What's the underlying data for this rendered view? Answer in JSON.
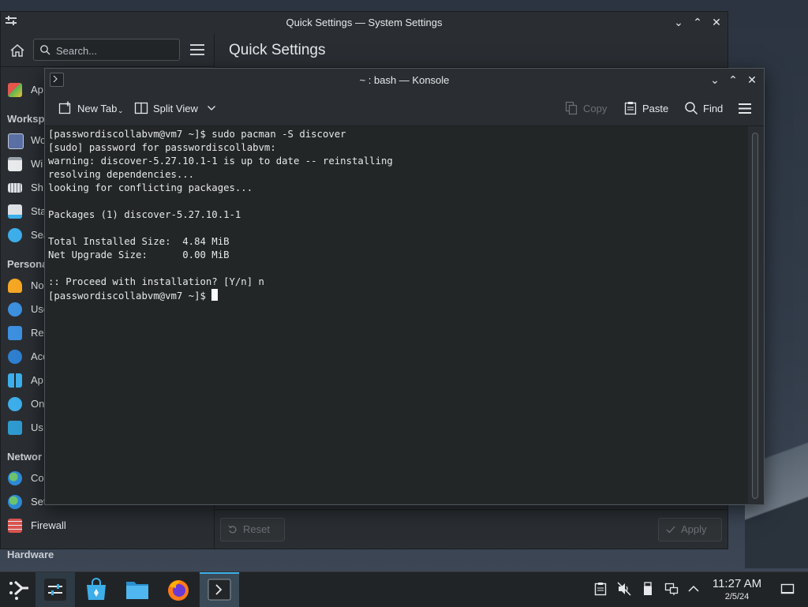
{
  "desktop": {
    "background_color": "#2f3a46"
  },
  "system_settings": {
    "title": "Quick Settings — System Settings",
    "search_placeholder": "Search...",
    "main_title": "Quick Settings",
    "sidebar": {
      "item_apps": "Ap",
      "section_workspace": "Worksp",
      "workspace_items": [
        "Wo",
        "Wi",
        "Sh",
        "Sta",
        "Sea"
      ],
      "section_personal": "Persona",
      "personal_items": [
        "No",
        "Use",
        "Re",
        "Acc",
        "Ap",
        "On",
        "Us"
      ],
      "section_network": "Networ",
      "network_items": [
        "Co",
        "Set",
        "Firewall"
      ],
      "section_hardware": "Hardware"
    },
    "reset_label": "Reset",
    "apply_label": "Apply"
  },
  "konsole": {
    "title": "~ : bash — Konsole",
    "toolbar": {
      "new_tab": "New Tab",
      "split_view": "Split View",
      "copy": "Copy",
      "paste": "Paste",
      "find": "Find"
    },
    "terminal_lines": [
      "[passwordiscollabvm@vm7 ~]$ sudo pacman -S discover",
      "[sudo] password for passwordiscollabvm:",
      "warning: discover-5.27.10.1-1 is up to date -- reinstalling",
      "resolving dependencies...",
      "looking for conflicting packages...",
      "",
      "Packages (1) discover-5.27.10.1-1",
      "",
      "Total Installed Size:  4.84 MiB",
      "Net Upgrade Size:      0.00 MiB",
      "",
      ":: Proceed with installation? [Y/n] n"
    ],
    "prompt": "[passwordiscollabvm@vm7 ~]$ "
  },
  "taskbar": {
    "clock_time": "11:27 AM",
    "clock_date": "2/5/24",
    "accent_color": "#3daee9"
  }
}
